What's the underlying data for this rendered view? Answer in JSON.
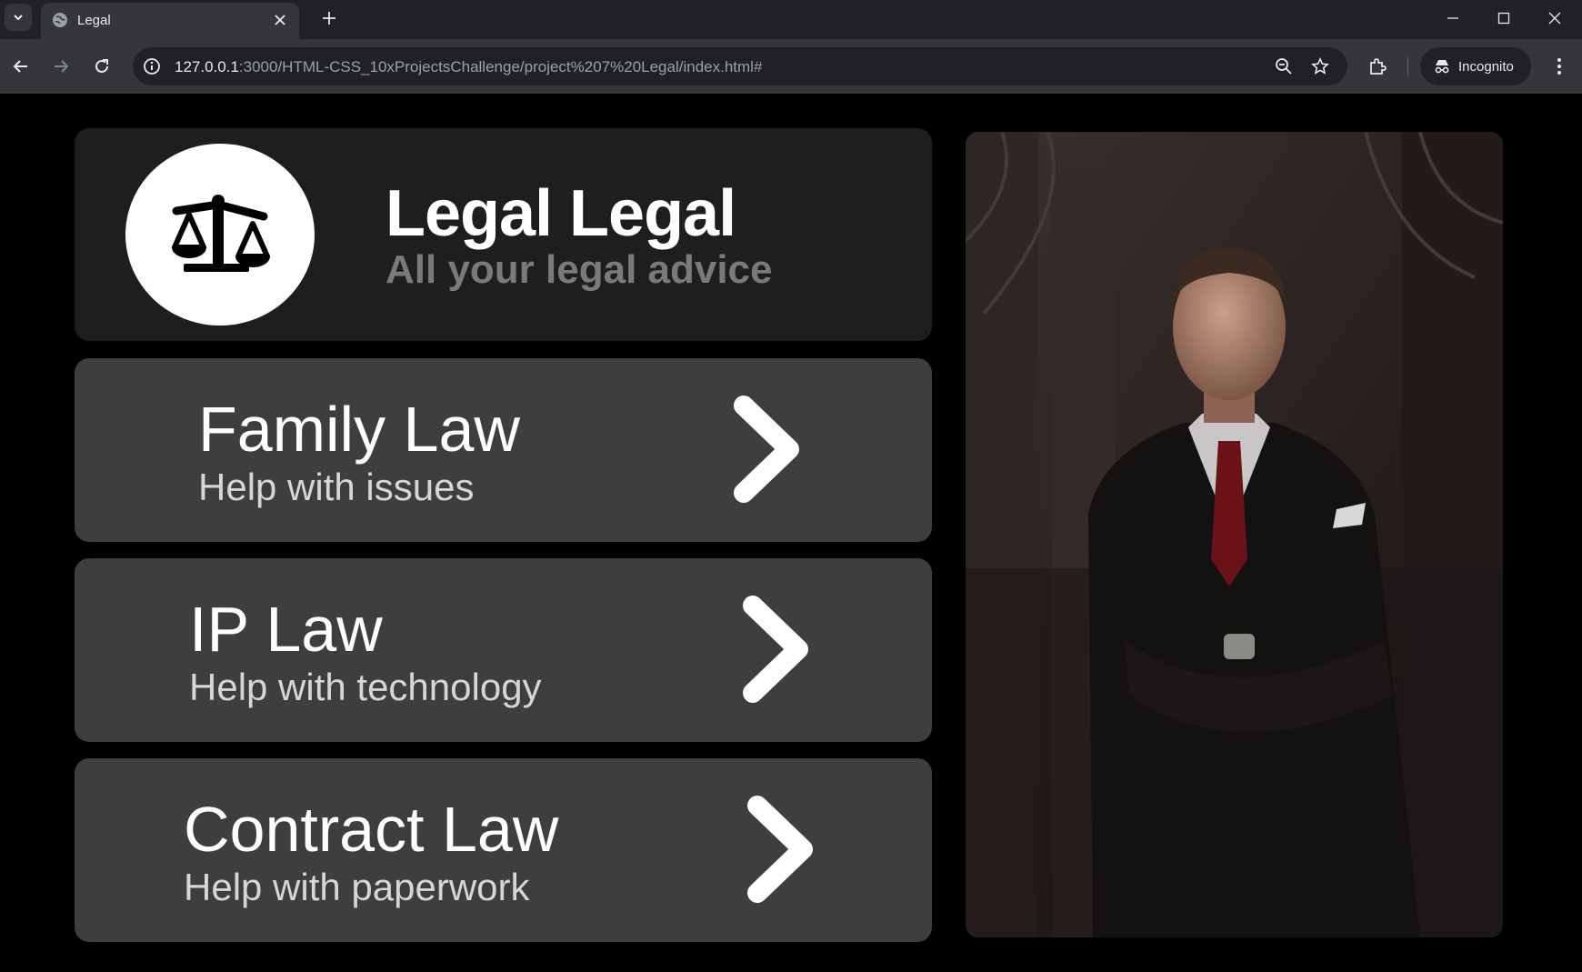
{
  "browser": {
    "tab_title": "Legal",
    "url_host": "127.0.0.1",
    "url_rest": ":3000/HTML-CSS_10xProjectsChallenge/project%207%20Legal/index.html#",
    "profile_label": "Incognito"
  },
  "hero": {
    "title": "Legal Legal",
    "subtitle": "All your legal advice"
  },
  "services": [
    {
      "title": "Family Law",
      "subtitle": "Help with issues"
    },
    {
      "title": "IP Law",
      "subtitle": "Help with technology"
    },
    {
      "title": "Contract Law",
      "subtitle": "Help with paperwork"
    }
  ],
  "colors": {
    "page_bg": "#000000",
    "hero_card_bg": "#1e1e1e",
    "service_card_bg": "#3e3e3e",
    "subtitle_gray": "#7a7a7a"
  },
  "icons": [
    "scales-of-justice-icon",
    "chevron-right-icon"
  ]
}
